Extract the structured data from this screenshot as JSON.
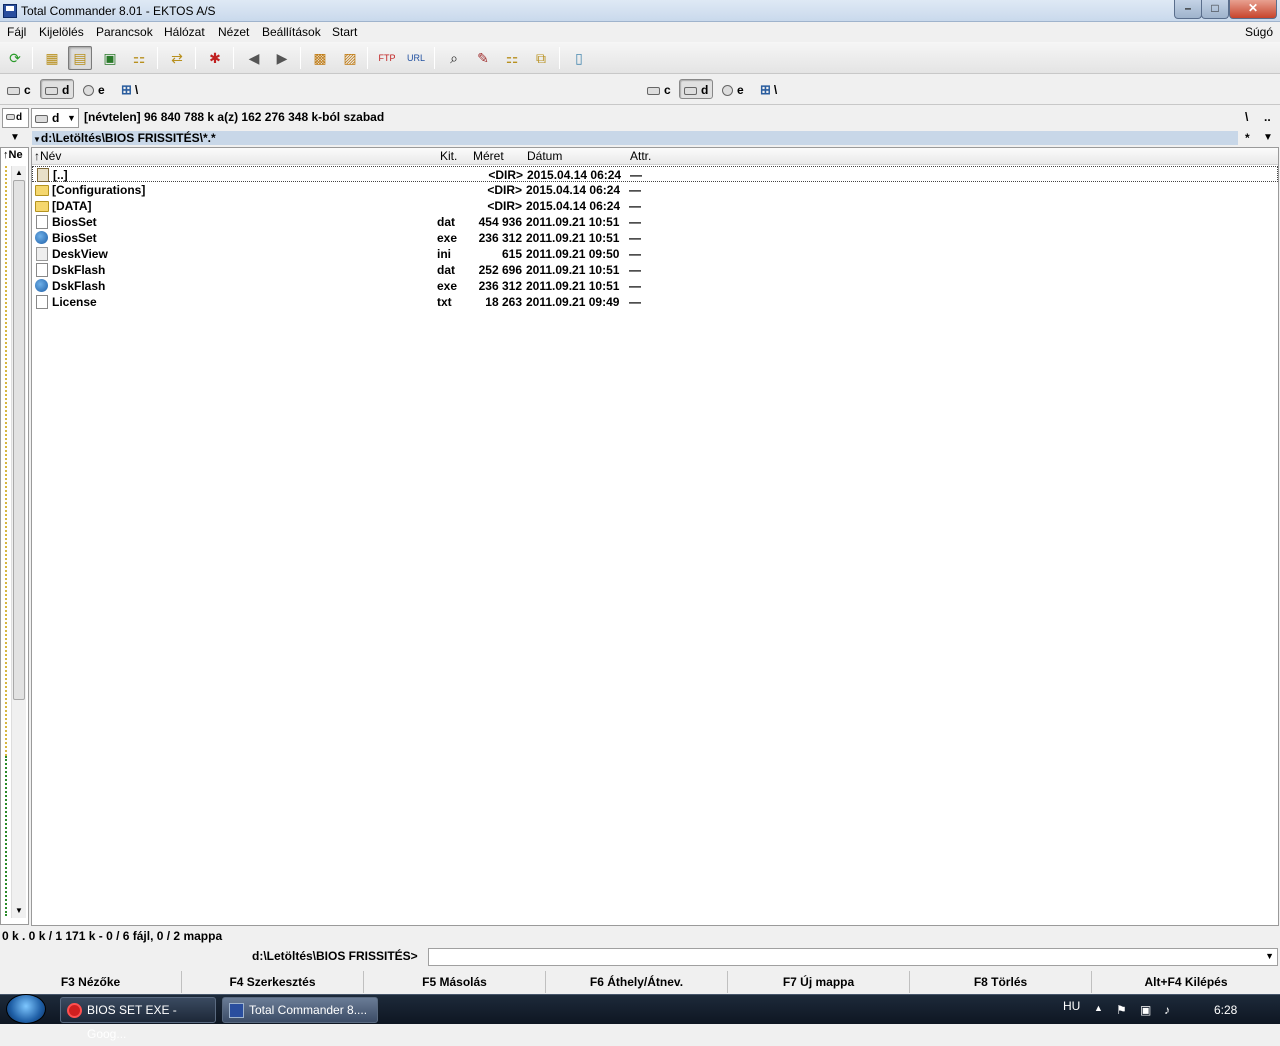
{
  "window": {
    "title": "Total Commander 8.01 - EKTOS A/S",
    "min": "–",
    "max": "□",
    "close": "✕"
  },
  "menu": {
    "items": [
      "Fájl",
      "Kijelölés",
      "Parancsok",
      "Hálózat",
      "Nézet",
      "Beállítások",
      "Start"
    ],
    "help": "Súgó"
  },
  "drives_left": {
    "c": "c",
    "d": "d",
    "e": "e",
    "net": "\\"
  },
  "drives_right": {
    "c": "c",
    "d": "d",
    "e": "e",
    "net": "\\"
  },
  "panel": {
    "left_combo": "d",
    "small_combo": "d",
    "volume_info": "[névtelen]  96 840 788 k a(z) 162 276 348 k-ból szabad",
    "root_btn": "\\",
    "up_btn": "..",
    "path": "d:\\Letöltés\\BIOS FRISSITÉS\\*.*",
    "star": "*",
    "left_col_header": "Ne"
  },
  "columns": {
    "name": "Név",
    "ext": "Kit.",
    "size": "Méret",
    "date": "Dátum",
    "attr": "Attr."
  },
  "files": [
    {
      "name": "[..]",
      "ext": "",
      "size": "<DIR>",
      "date": "2015.04.14 06:24",
      "attr": "—",
      "icon": "up-icon"
    },
    {
      "name": "[Configurations]",
      "ext": "",
      "size": "<DIR>",
      "date": "2015.04.14 06:24",
      "attr": "—",
      "icon": "folder-icon"
    },
    {
      "name": "[DATA]",
      "ext": "",
      "size": "<DIR>",
      "date": "2015.04.14 06:24",
      "attr": "—",
      "icon": "folder-icon"
    },
    {
      "name": "BiosSet",
      "ext": "dat",
      "size": "454 936",
      "date": "2011.09.21 10:51",
      "attr": "—",
      "icon": "file-icon"
    },
    {
      "name": "BiosSet",
      "ext": "exe",
      "size": "236 312",
      "date": "2011.09.21 10:51",
      "attr": "—",
      "icon": "exe-icon"
    },
    {
      "name": "DeskView",
      "ext": "ini",
      "size": "615",
      "date": "2011.09.21 09:50",
      "attr": "—",
      "icon": "ini-icon"
    },
    {
      "name": "DskFlash",
      "ext": "dat",
      "size": "252 696",
      "date": "2011.09.21 10:51",
      "attr": "—",
      "icon": "file-icon"
    },
    {
      "name": "DskFlash",
      "ext": "exe",
      "size": "236 312",
      "date": "2011.09.21 10:51",
      "attr": "—",
      "icon": "exe-icon"
    },
    {
      "name": "License",
      "ext": "txt",
      "size": "18 263",
      "date": "2011.09.21 09:49",
      "attr": "—",
      "icon": "file-icon"
    }
  ],
  "status": "0 k . 0 k / 1 171 k - 0 / 6 fájl, 0 / 2 mappa",
  "cmdline": {
    "label": "d:\\Letöltés\\BIOS FRISSITÉS>"
  },
  "fkeys": [
    "F3 Nézőke",
    "F4 Szerkesztés",
    "F5 Másolás",
    "F6 Áthely/Átnev.",
    "F7 Új mappa",
    "F8 Törlés",
    "Alt+F4 Kilépés"
  ],
  "taskbar": {
    "tasks": [
      "BIOS SET EXE - Goog...",
      "Total Commander 8...."
    ],
    "lang": "HU",
    "time": "6:28"
  }
}
